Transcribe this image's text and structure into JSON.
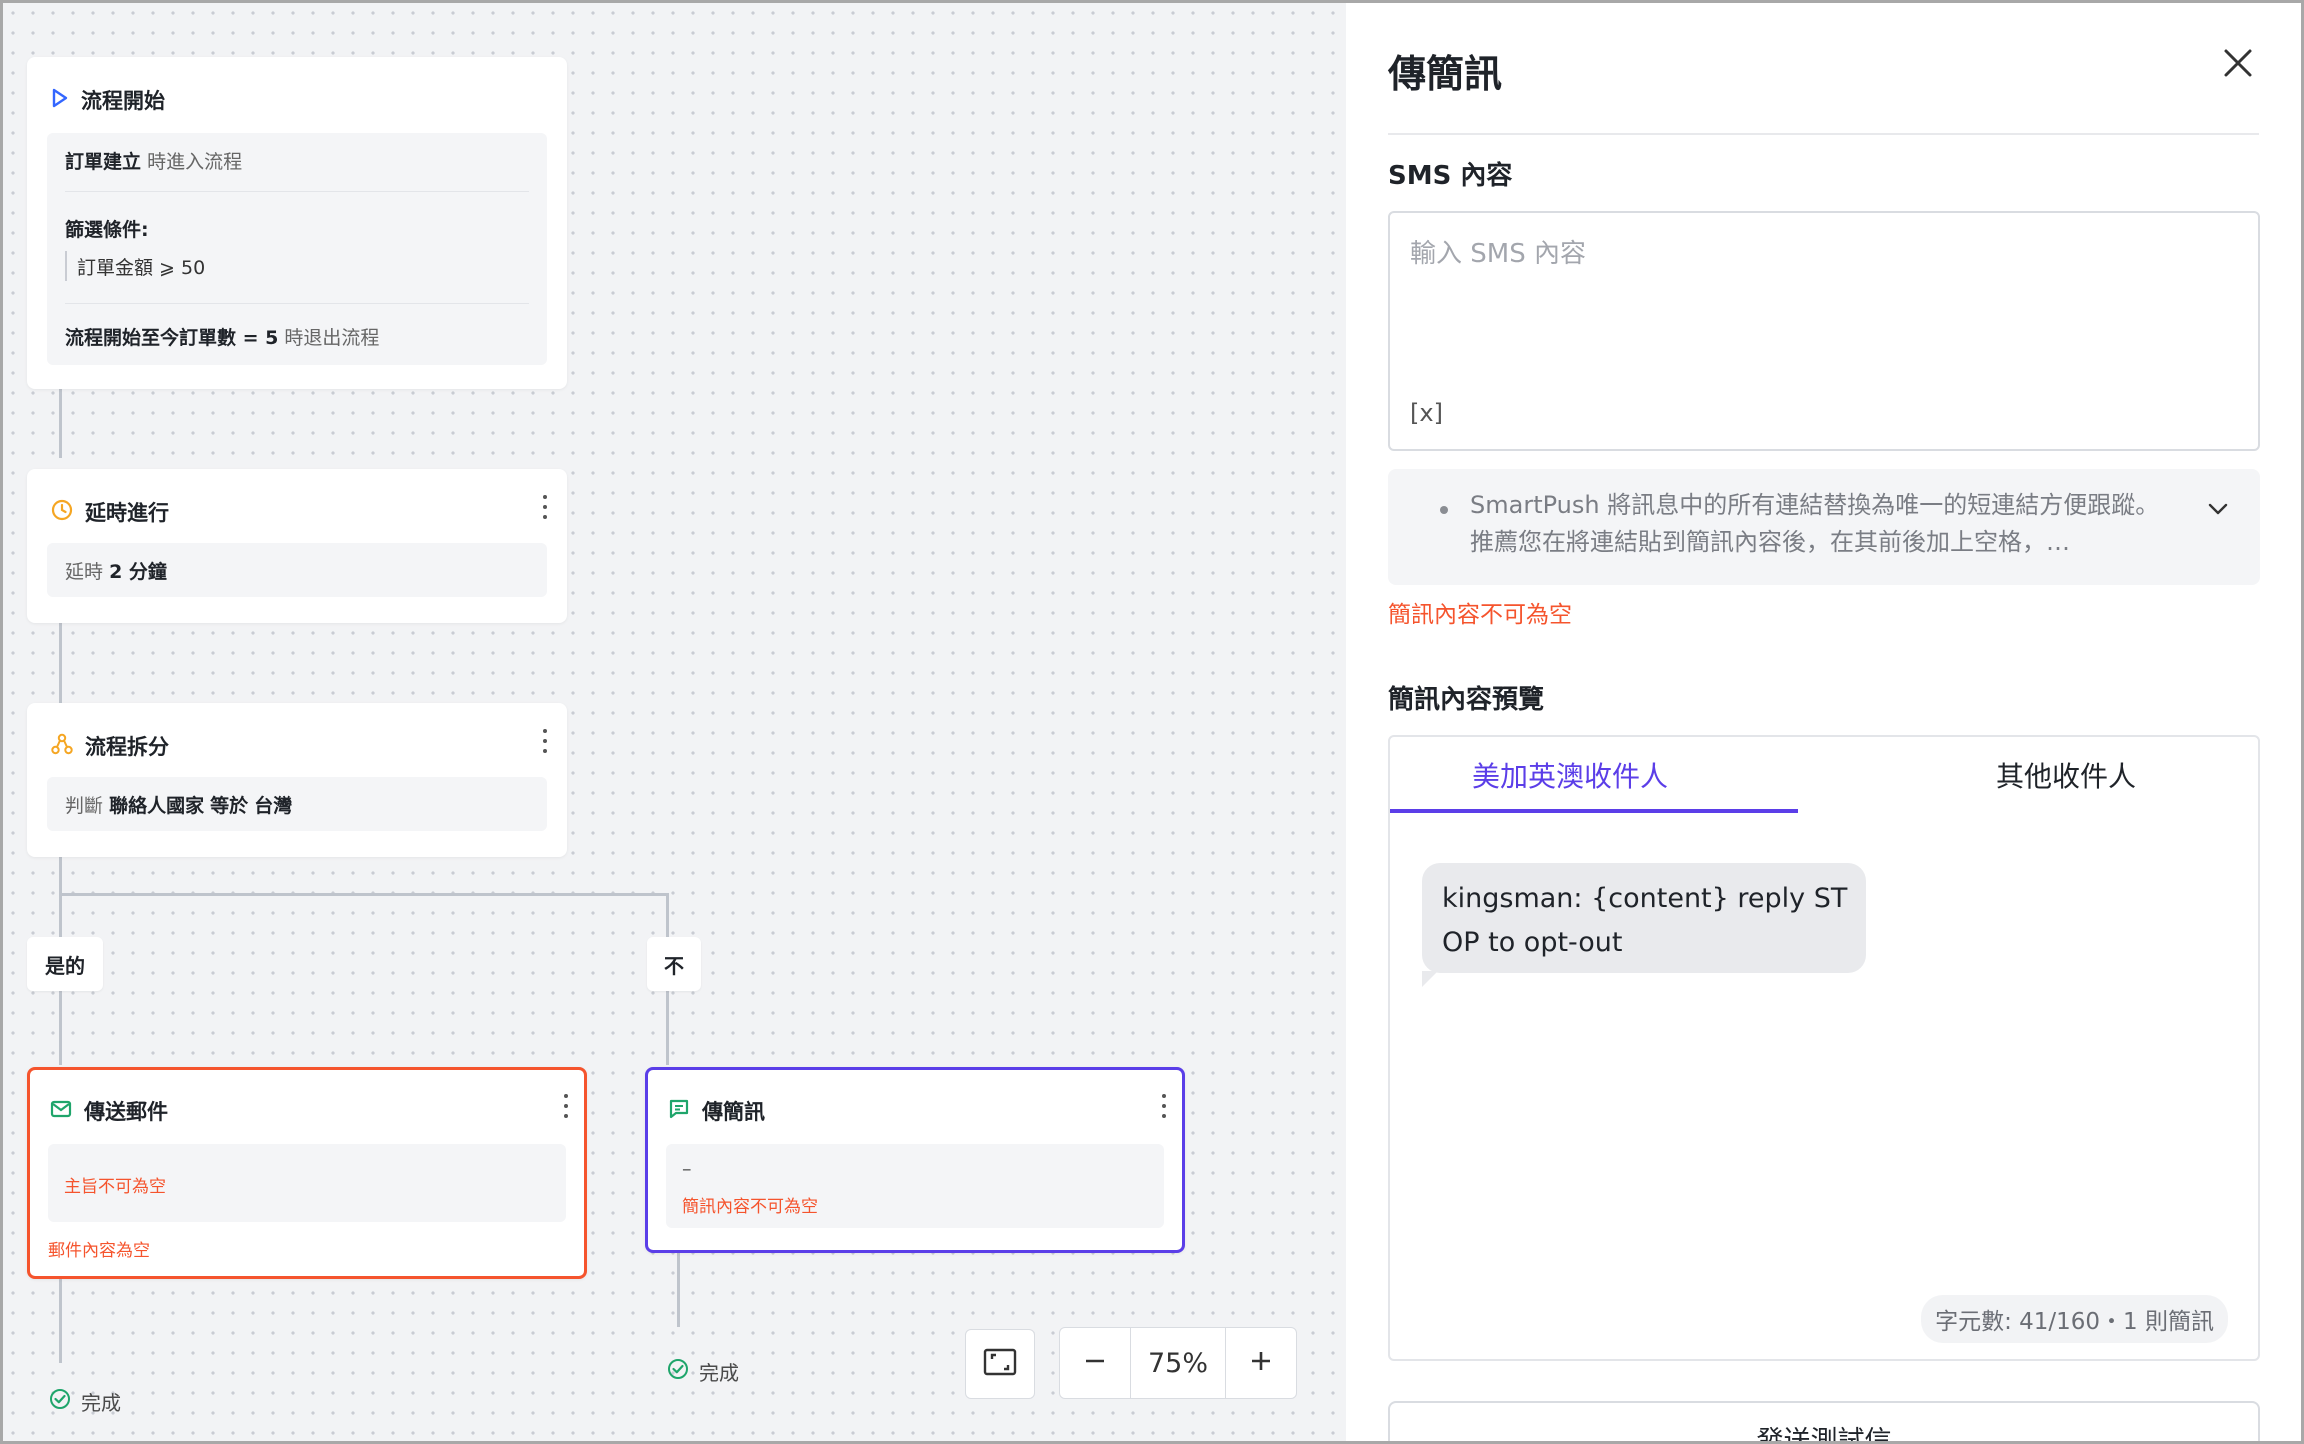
{
  "flow": {
    "start": {
      "title": "流程開始",
      "trigger_event": "訂單建立",
      "trigger_suffix": "時進入流程",
      "filter_label": "篩選條件:",
      "filter_rule": "訂單金額 ⩾ 50",
      "exit_rule_bold": "流程開始至今訂單數 = 5",
      "exit_rule_suffix": "時退出流程"
    },
    "delay": {
      "title": "延時進行",
      "prefix": "延時",
      "value": "2 分鐘"
    },
    "split": {
      "title": "流程拆分",
      "prefix": "判斷",
      "field": "聯絡人國家",
      "operator": "等於",
      "value": "台灣"
    },
    "branch_yes": "是的",
    "branch_no": "不",
    "email_node": {
      "title": "傳送郵件",
      "inner_error": "主旨不可為空",
      "outer_error": "郵件內容為空"
    },
    "sms_node": {
      "title": "傳簡訊",
      "placeholder": "–",
      "error": "簡訊內容不可為空"
    },
    "done_label": "完成",
    "zoom": "75%"
  },
  "panel": {
    "title": "傳簡訊",
    "sms_label": "SMS 內容",
    "sms_placeholder": "輸入 SMS 內容",
    "variable_token": "[x]",
    "tip": "SmartPush 將訊息中的所有連結替換為唯一的短連結方便跟蹤。推薦您在將連結貼到簡訊內容後，在其前後加上空格，…",
    "error": "簡訊內容不可為空",
    "preview_label": "簡訊內容預覽",
    "tabs": [
      "美加英澳收件人",
      "其他收件人"
    ],
    "preview_message": "kingsman: {content} reply STOP to opt-out",
    "char_count": "字元數: 41/160・1 則簡訊",
    "test_button": "發送測試信"
  },
  "colors": {
    "accent": "#5b3ee8",
    "error": "#f5542d",
    "email_green": "#1fa56b",
    "delay_orange": "#f5a623",
    "start_blue": "#3366ff"
  },
  "icons": [
    "play-icon",
    "clock-icon",
    "split-icon",
    "mail-icon",
    "message-icon",
    "check-circle-icon",
    "fit-screen-icon",
    "minus-icon",
    "plus-icon",
    "close-icon",
    "chevron-down-icon",
    "kebab-icon"
  ]
}
